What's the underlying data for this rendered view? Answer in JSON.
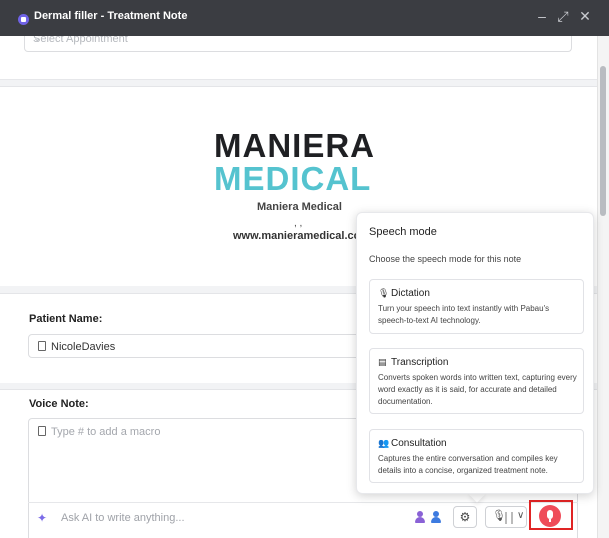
{
  "window": {
    "title": "Dermal filler - Treatment Note",
    "minimize_glyph": "–",
    "maximize_glyph": "⤢",
    "close_glyph": "✕"
  },
  "appointment": {
    "placeholder": "Select Appointment",
    "chevron": "⌄"
  },
  "header": {
    "logo_top": "MANIERA",
    "logo_bottom": "MEDICAL",
    "company_name": "Maniera Medical",
    "address": ", ,",
    "website": "www.manieramedical.co"
  },
  "patient": {
    "label": "Patient Name:",
    "value": "NicoleDavies"
  },
  "voice_note": {
    "label": "Voice Note:",
    "placeholder": "Type # to add a macro"
  },
  "ai_bar": {
    "placeholder": "Ask AI to write anything...",
    "sparkle_icon": "✦",
    "gear_icon": "⚙",
    "mic_icon": "🎙",
    "caret": "∨"
  },
  "speech_mode": {
    "title": "Speech mode",
    "subtitle": "Choose the speech mode for this note",
    "modes": [
      {
        "icon": "mic-icon",
        "glyph": "🎙",
        "name": "Dictation",
        "description": "Turn your speech into text instantly with Pabau's speech-to-text AI technology."
      },
      {
        "icon": "document-icon",
        "glyph": "▤",
        "name": "Transcription",
        "description": "Converts spoken words into written text, capturing every word exactly as it is said, for accurate and detailed documentation."
      },
      {
        "icon": "people-icon",
        "glyph": "👥",
        "name": "Consultation",
        "description": "Captures the entire conversation and compiles key details into a concise, organized treatment note."
      }
    ]
  },
  "colors": {
    "titlebar": "#3b3d42",
    "accent_purple": "#6f62e6",
    "logo_teal": "#55c3cf",
    "record_red": "#ef4c59",
    "highlight_red": "#e02424",
    "person_purple": "#8a62d6",
    "person_blue": "#3d7be0"
  }
}
